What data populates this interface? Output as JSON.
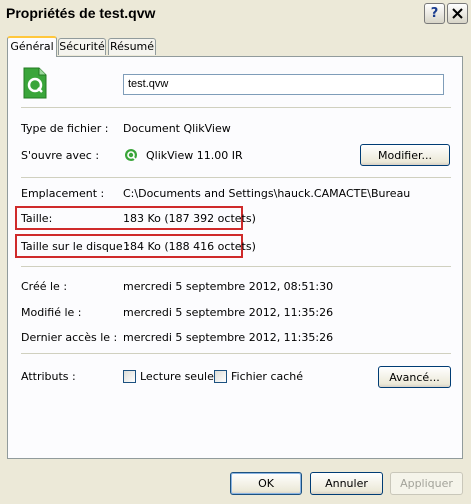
{
  "window": {
    "title": "Propriétés de test.qvw",
    "help_label": "?"
  },
  "tabs": [
    {
      "label": "Général",
      "active": true
    },
    {
      "label": "Sécurité",
      "active": false
    },
    {
      "label": "Résumé",
      "active": false
    }
  ],
  "general": {
    "file_name": "test.qvw",
    "file_type_label": "Type de fichier :",
    "file_type_value": "Document QlikView",
    "opens_with_label": "S'ouvre avec :",
    "opens_with_value": "QlikView 11.00 IR",
    "change_button": "Modifier...",
    "location_label": "Emplacement :",
    "location_value": "C:\\Documents and Settings\\hauck.CAMACTE\\Bureau",
    "size_label": "Taille:",
    "size_value": "183 Ko (187 392 octets)",
    "size_on_disk_label": "Taille sur le disque :",
    "size_on_disk_value": "184 Ko (188 416 octets)",
    "created_label": "Créé le :",
    "created_value": "mercredi 5 septembre 2012, 08:51:30",
    "modified_label": "Modifié le :",
    "modified_value": "mercredi 5 septembre 2012, 11:35:26",
    "accessed_label": "Dernier accès le :",
    "accessed_value": "mercredi 5 septembre 2012, 11:35:26",
    "attributes_label": "Attributs :",
    "readonly_label": "Lecture seule",
    "readonly_checked": false,
    "hidden_label": "Fichier caché",
    "hidden_checked": false,
    "advanced_button": "Avancé..."
  },
  "footer": {
    "ok": "OK",
    "cancel": "Annuler",
    "apply": "Appliquer"
  },
  "colors": {
    "highlight": "#cf2a2a",
    "qlik_green": "#3aa53a"
  }
}
